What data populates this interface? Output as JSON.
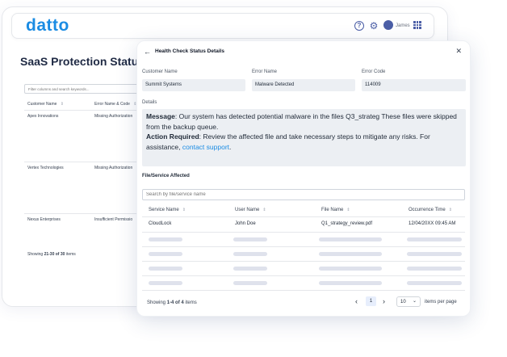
{
  "app": {
    "logo": "datto",
    "user_name": "James",
    "page_title": "SaaS Protection Status",
    "filter_placeholder": "Filter columns and search keywords...",
    "table_headers": [
      "Customer Name",
      "Error Name & Code"
    ],
    "rows": [
      {
        "customer": "Apex Innovations",
        "error": "Missing Authorization"
      },
      {
        "customer": "Vertex Technologies",
        "error": "Missing Authorization"
      },
      {
        "customer": "Nexus Enterprises",
        "error": "Insufficient Permissio"
      }
    ],
    "showing_prefix": "Showing ",
    "showing_range": "21-30 of 30",
    "showing_suffix": " items"
  },
  "modal": {
    "title": "Health Check Status Details",
    "fields": [
      {
        "label": "Customer Name",
        "value": "Summit Systems"
      },
      {
        "label": "Error Name",
        "value": "Malware Detected"
      },
      {
        "label": "Error Code",
        "value": "114009"
      }
    ],
    "details_label": "Details",
    "message_label": "Message",
    "message_text": ": Our system has detected potential malware in the files Q3_strateg These files were skipped from the backup queue.",
    "action_label": "Action Required",
    "action_text": ": Review the affected file and take necessary steps to mitigate any risks. For assistance, ",
    "support_link": "contact support",
    "action_end": ".",
    "files_label": "File/Service Affected",
    "search_placeholder": "Search by file/service name",
    "columns": [
      "Service Name",
      "User Name",
      "File Name",
      "Occurrence Time"
    ],
    "first_row": {
      "service": "CloudLock",
      "user": "John Doe",
      "file": "Q1_strategy_review.pdf",
      "time": "12/04/20XX 09:45 AM"
    },
    "showing_prefix": "Showing ",
    "showing_range": "1-4 of 4",
    "showing_suffix": " items",
    "current_page": "1",
    "per_page": "10",
    "per_page_label": "items per page"
  },
  "colors": {
    "brand": "#1b8ce3",
    "accent": "#4b5ea6",
    "link": "#1b8ce3"
  }
}
